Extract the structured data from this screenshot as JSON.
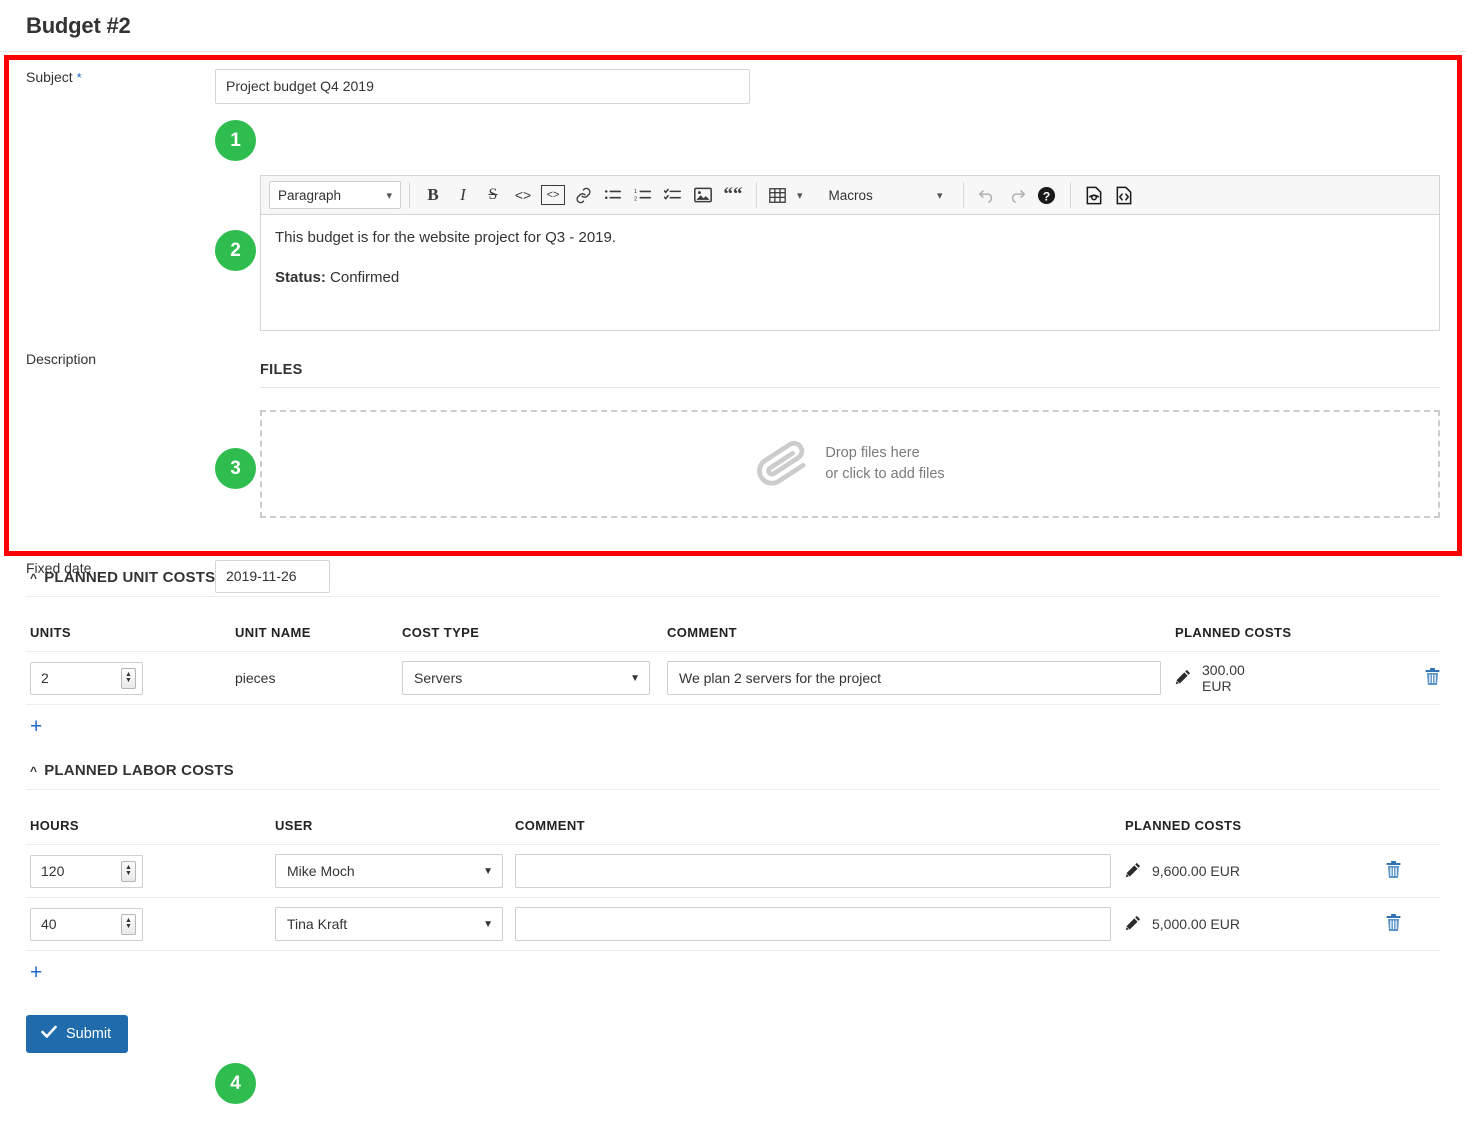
{
  "page": {
    "title": "Budget #2"
  },
  "form": {
    "subject": {
      "label": "Subject",
      "required_marker": "*",
      "value": "Project budget Q4 2019",
      "badge": "1"
    },
    "description": {
      "label": "Description",
      "badge": "2",
      "toolbar": {
        "paragraph_style": "Paragraph",
        "macros_label": "Macros",
        "buttons": [
          "bold-icon",
          "italic-icon",
          "strikethrough-icon",
          "inline-code-icon",
          "code-block-icon",
          "link-icon",
          "bulleted-list-icon",
          "numbered-list-icon",
          "checklist-icon",
          "image-icon",
          "quote-icon",
          "table-icon",
          "undo-icon",
          "redo-icon",
          "help-icon",
          "preview-icon",
          "source-code-icon"
        ]
      },
      "body": {
        "paragraph_1": "This budget is for the website project for Q3 - 2019.",
        "status_label": "Status:",
        "status_value": "Confirmed"
      }
    },
    "files": {
      "title": "FILES",
      "badge": "3",
      "drop_line_1": "Drop files here",
      "drop_line_2": "or click to add files"
    },
    "fixed_date": {
      "label": "Fixed date",
      "value": "2019-11-26",
      "badge": "4"
    }
  },
  "unit_costs": {
    "section_title": "PLANNED UNIT COSTS",
    "columns": [
      "UNITS",
      "UNIT NAME",
      "COST TYPE",
      "COMMENT",
      "PLANNED COSTS"
    ],
    "rows": [
      {
        "units": "2",
        "unit_name": "pieces",
        "cost_type": "Servers",
        "comment": "We plan 2 servers for the project",
        "planned_costs": "300.00 EUR"
      }
    ],
    "add_label": "+"
  },
  "labor_costs": {
    "section_title": "PLANNED LABOR COSTS",
    "columns": [
      "HOURS",
      "USER",
      "COMMENT",
      "PLANNED COSTS"
    ],
    "rows": [
      {
        "hours": "120",
        "user": "Mike Moch",
        "comment": "",
        "planned_costs": "9,600.00 EUR"
      },
      {
        "hours": "40",
        "user": "Tina Kraft",
        "comment": "",
        "planned_costs": "5,000.00 EUR"
      }
    ],
    "add_label": "+"
  },
  "actions": {
    "submit_label": "Submit"
  },
  "colors": {
    "badge_green": "#2ebd4e",
    "highlight_red": "#ff0000",
    "primary_blue": "#1f6bab",
    "link_blue": "#1b6ac9"
  }
}
